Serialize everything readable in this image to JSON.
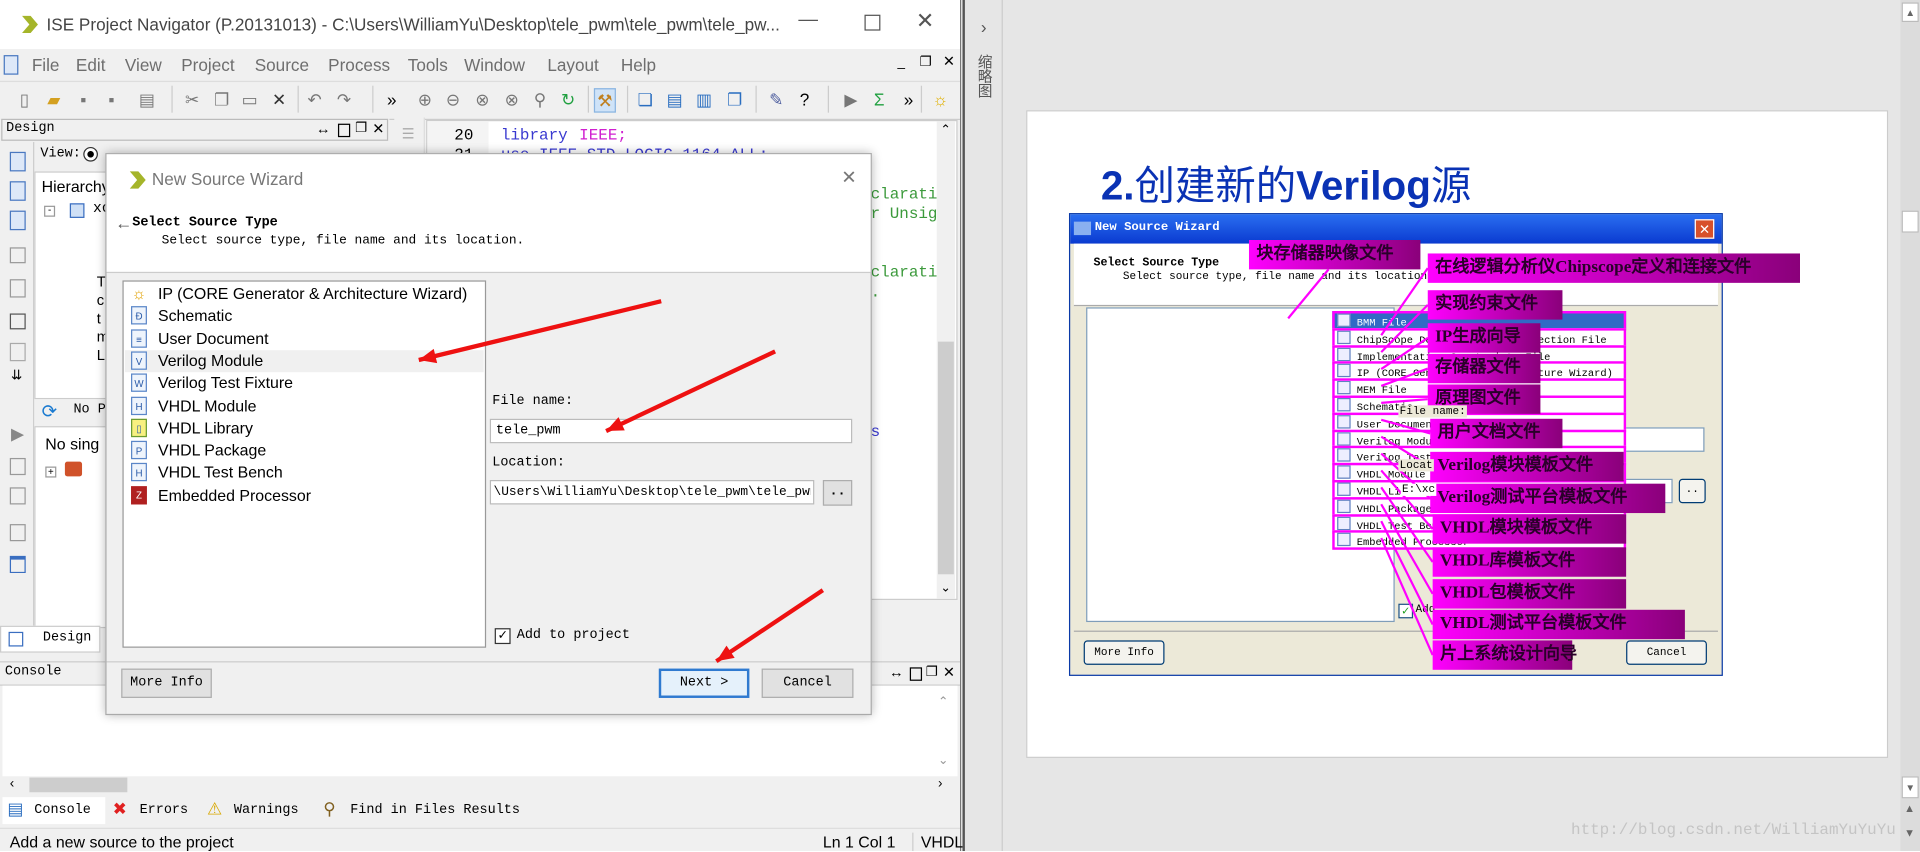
{
  "ise_window": {
    "title": "ISE Project Navigator (P.20131013) - C:\\Users\\WilliamYu\\Desktop\\tele_pwm\\tele_pwm\\tele_pw...",
    "window_controls": [
      "minimize-icon",
      "maximize-icon",
      "close-icon"
    ],
    "menu": [
      "File",
      "Edit",
      "View",
      "Project",
      "Source",
      "Process",
      "Tools",
      "Window",
      "Layout",
      "Help"
    ],
    "toolbar_icons": [
      "new-file-icon",
      "open-icon",
      "save-icon",
      "save-all-icon",
      "print-icon",
      "cut-icon",
      "copy-icon",
      "paste-icon",
      "delete-icon",
      "undo-icon",
      "redo-icon",
      "overflow-icon",
      "zoom-in-icon",
      "zoom-out-icon",
      "zoom-fit-icon",
      "zoom-full-icon",
      "find-icon",
      "refresh-icon",
      "design-tool-icon",
      "cascade-icon",
      "tile-horizontal-icon",
      "tile-vertical-icon",
      "window-icon",
      "wrench-icon",
      "help-icon",
      "run-icon",
      "sigma-icon",
      "overflow-icon",
      "bulb-icon"
    ],
    "design_panel": {
      "title": "Design",
      "view_label": "View:",
      "hierarchy_label": "Hierarchy",
      "tree_item": "xc",
      "partial_lines": [
        "T",
        "c",
        "t",
        "m",
        "Li"
      ],
      "process_label": "No P",
      "process_item": "No sing",
      "tab": "Design"
    },
    "editor": {
      "line_numbers": [
        "20",
        "21"
      ],
      "code_keyword": "library",
      "code_lib": "IEEE;",
      "code_line21": "use IEEE.STD_LOGIC_1164.ALL;",
      "fragments": [
        "clarati",
        "r Unsig",
        "clarati",
        ".",
        "s"
      ]
    },
    "console": {
      "title": "Console",
      "tabs": [
        "Console",
        "Errors",
        "Warnings",
        "Find in Files Results"
      ]
    },
    "status": {
      "message": "Add a new source to the project",
      "position": "Ln 1 Col 1",
      "language": "VHDL"
    }
  },
  "wizard": {
    "title": "New Source Wizard",
    "heading": "Select Source Type",
    "subheading": "Select source type, file name and its location.",
    "source_types": [
      {
        "label": "IP (CORE Generator & Architecture Wizard)",
        "icon": "ip-bulb-icon"
      },
      {
        "label": "Schematic",
        "icon": "schematic-icon"
      },
      {
        "label": "User Document",
        "icon": "document-icon"
      },
      {
        "label": "Verilog Module",
        "icon": "verilog-module-icon"
      },
      {
        "label": "Verilog Test Fixture",
        "icon": "verilog-test-fixture-icon"
      },
      {
        "label": "VHDL Module",
        "icon": "vhdl-module-icon"
      },
      {
        "label": "VHDL Library",
        "icon": "vhdl-library-icon"
      },
      {
        "label": "VHDL Package",
        "icon": "vhdl-package-icon"
      },
      {
        "label": "VHDL Test Bench",
        "icon": "vhdl-test-bench-icon"
      },
      {
        "label": "Embedded Processor",
        "icon": "embedded-processor-icon"
      }
    ],
    "selected": "Verilog Module",
    "file_name_label": "File name:",
    "file_name_value": "tele_pwm",
    "location_label": "Location:",
    "location_value": "\\Users\\WilliamYu\\Desktop\\tele_pwm\\tele_pwm",
    "browse_label": "..",
    "add_to_project_label": "Add to project",
    "add_to_project_checked": true,
    "more_info_label": "More Info",
    "next_label": "Next >",
    "cancel_label": "Cancel",
    "annotation_color": "#ee1111"
  },
  "doc_viewer": {
    "sidebar_label": "缩略图",
    "sidebar_toggle": "›",
    "page_heading_num": "2.",
    "page_heading": "创建新的",
    "page_heading_bold": "Verilog",
    "page_heading_end": "源",
    "heading_color": "#0a32b4",
    "watermark": "http://blog.csdn.net/WilliamYuYuYu",
    "embedded_wizard": {
      "title": "New Source Wizard",
      "heading": "Select Source Type",
      "subheading": "Select source type, file name and its location.",
      "rows": [
        "BMM File",
        "ChipScope Definition and Connection File",
        "Implementation Constraints File",
        "IP (CORE Generator & Architecture Wizard)",
        "MEM File",
        "Schematic",
        "User Document",
        "Verilog Module",
        "Verilog Test Fixture",
        "VHDL Module",
        "VHDL Library",
        "VHDL Package",
        "VHDL Test Bench",
        "Embedded Processor"
      ],
      "callouts": [
        "块存储器映像文件",
        "在线逻辑分析仪Chipscope定义和连接文件",
        "实现约束文件",
        "IP生成向导",
        "存储器文件",
        "原理图文件",
        "用户文档文件",
        "Verilog模块模板文件",
        "Verilog测试平台模板文件",
        "VHDL模块模板文件",
        "VHDL库模板文件",
        "VHDL包模板文件",
        "VHDL测试平台模板文件",
        "片上系统设计向导"
      ],
      "file_name_label": "File name:",
      "location_label": "Locat",
      "location_value": "E:\\xc",
      "browse_label": "..",
      "add_label": "Add",
      "more_info_label": "More Info",
      "cancel_label": "Cancel",
      "callout_color": "#ff00ff"
    }
  }
}
